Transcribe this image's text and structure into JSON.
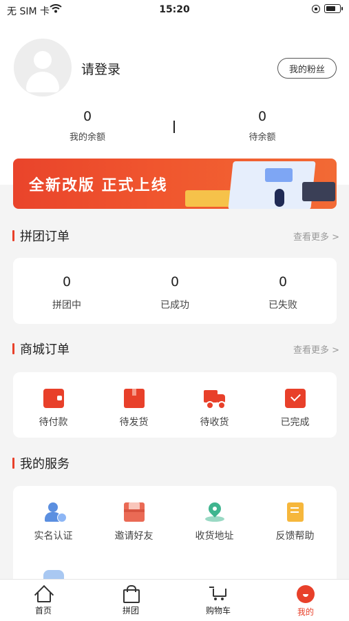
{
  "status_bar": {
    "carrier": "无 SIM 卡",
    "time": "15:20"
  },
  "profile": {
    "login_text": "请登录",
    "fans_button": "我的粉丝",
    "balance": {
      "value": "0",
      "label": "我的余额"
    },
    "pending_balance": {
      "value": "0",
      "label": "待余额"
    }
  },
  "banner": {
    "text": "全新改版 正式上线"
  },
  "group_orders": {
    "title": "拼团订单",
    "more": "查看更多 >",
    "stats": [
      {
        "value": "0",
        "label": "拼团中"
      },
      {
        "value": "0",
        "label": "已成功"
      },
      {
        "value": "0",
        "label": "已失败"
      }
    ]
  },
  "mall_orders": {
    "title": "商城订单",
    "more": "查看更多 >",
    "items": [
      {
        "label": "待付款",
        "icon": "wallet-icon"
      },
      {
        "label": "待发货",
        "icon": "package-icon"
      },
      {
        "label": "待收货",
        "icon": "truck-icon"
      },
      {
        "label": "已完成",
        "icon": "completed-icon"
      }
    ]
  },
  "services": {
    "title": "我的服务",
    "items": [
      {
        "label": "实名认证",
        "icon": "user-verify-icon"
      },
      {
        "label": "邀请好友",
        "icon": "envelope-icon"
      },
      {
        "label": "收货地址",
        "icon": "location-pin-icon"
      },
      {
        "label": "反馈帮助",
        "icon": "note-icon"
      }
    ]
  },
  "tabbar": {
    "tabs": [
      {
        "label": "首页",
        "icon": "home-icon"
      },
      {
        "label": "拼团",
        "icon": "bag-icon"
      },
      {
        "label": "购物车",
        "icon": "cart-icon"
      },
      {
        "label": "我的",
        "icon": "profile-icon"
      }
    ],
    "active": "我的"
  },
  "colors": {
    "accent": "#e8402a",
    "background": "#f4f4f4"
  }
}
